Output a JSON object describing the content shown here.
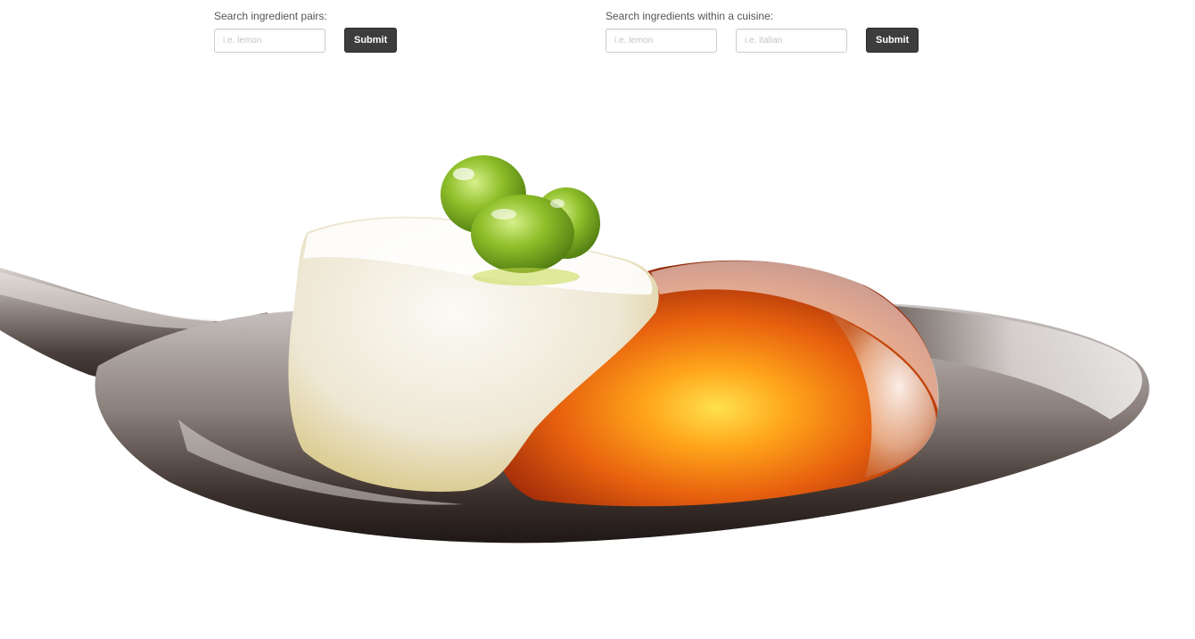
{
  "pair_search": {
    "label": "Search ingredient pairs:",
    "ingredient_placeholder": "i.e. lemon",
    "ingredient_value": "",
    "submit_label": "Submit"
  },
  "cuisine_search": {
    "label": "Search ingredients within a cuisine:",
    "ingredient_placeholder": "i.e. lemon",
    "ingredient_value": "",
    "cuisine_placeholder": "i.e. italian",
    "cuisine_value": "",
    "submit_label": "Submit"
  },
  "hero": {
    "subject": "spoon with molecular gastronomy dessert",
    "colors": {
      "spoon": "#8a7f7a",
      "cheese": "#f3efe6",
      "pearls": "#8fbf2a",
      "jelly": "#e8620e"
    }
  }
}
